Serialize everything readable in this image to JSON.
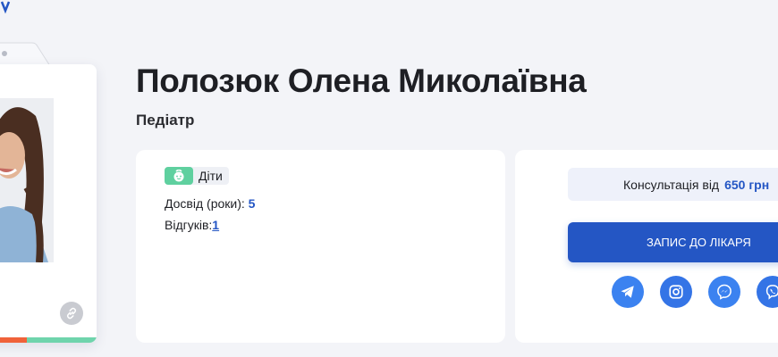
{
  "doctor": {
    "name": "Полозюк Олена Миколаївна",
    "specialty": "Педіатр"
  },
  "info": {
    "tag_label": "Діти",
    "experience_label": "Досвід (роки):",
    "experience_value": "5",
    "reviews_label": "Відгуків:",
    "reviews_value": "1"
  },
  "booking": {
    "price_label": "Консультація від",
    "price_value": "650 грн",
    "button_label": "ЗАПИС ДО ЛІКАРЯ"
  },
  "socials": [
    "telegram-icon",
    "instagram-icon",
    "messenger-icon",
    "viber-icon"
  ],
  "colors": {
    "accent": "#2456c4",
    "tag_green": "#5fd09f",
    "stripe_orange": "#f0623a",
    "stripe_green": "#6fd4ac",
    "background": "#f3f4f8"
  }
}
